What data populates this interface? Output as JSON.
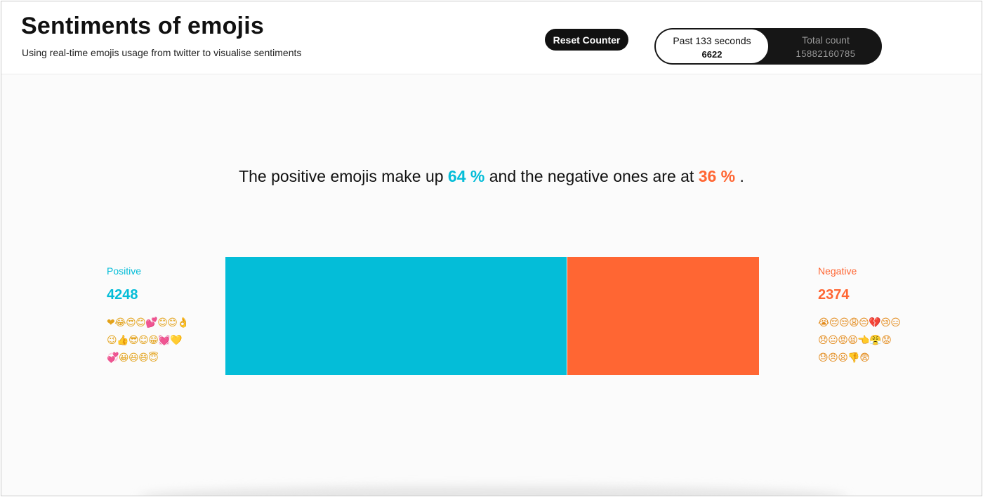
{
  "header": {
    "title": "Sentiments of emojis",
    "subtitle": "Using real-time emojis usage from twitter to visualise sentiments",
    "reset_label": "Reset Counter",
    "past_label": "Past 133 seconds",
    "past_value": "6622",
    "total_label": "Total count",
    "total_value": "15882160785"
  },
  "summary": {
    "text_before": "The positive emojis make up ",
    "positive_pct": "64 %",
    "text_middle": " and the negative ones are at ",
    "negative_pct": "36 %",
    "text_after": " ."
  },
  "positive": {
    "label": "Positive",
    "count": "4248",
    "emojis": "❤😂😍😊💕😊😊👌😉👍😎😊😁💓💛💞😀😃😄😇",
    "color": "#04bdd8",
    "fraction": 0.64
  },
  "negative": {
    "label": "Negative",
    "count": "2374",
    "emojis": "😭😔😒😩😔💔😢😑😞😐😡😫👈😤😟😓😠😦👎😨",
    "color": "#ff6633",
    "fraction": 0.36
  }
}
